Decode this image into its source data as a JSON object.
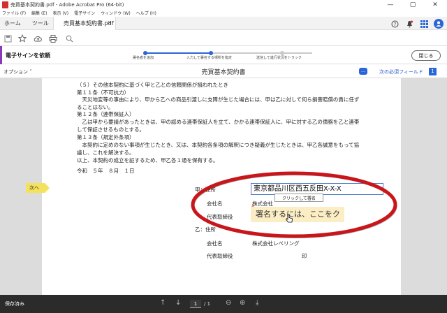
{
  "window": {
    "title": "売買基本契約書.pdf - Adobe Acrobat Pro (64-bit)",
    "minimize": "—",
    "maximize": "▢",
    "close": "✕"
  },
  "menu": [
    "ファイル (F)",
    "編集 (E)",
    "表示 (V)",
    "電子サイン",
    "ウィンドウ (W)",
    "ヘルプ (H)"
  ],
  "tabs": {
    "home": "ホーム",
    "tools": "ツール",
    "document": "売買基本契約書.pdf",
    "close": "✕"
  },
  "sign_bar": {
    "label": "電子サインを依頼",
    "steps": [
      "署名者を追加",
      "入力して署名する場所を指定",
      "送信して進行状況をトラック"
    ],
    "close_button": "閉じる"
  },
  "doc_header": {
    "options": "オプション ˅",
    "title": "売買基本契約書",
    "next_required": "次の必須フィールド",
    "required_count": "1"
  },
  "document": {
    "lines": [
      "（５）その他本契約に基づく甲と乙との信頼関係が損われたとき",
      "第１１条（不可抗力）",
      "　天災地変等の事由により、甲から乙への商品引渡しに支障が生じた場合には、甲は乙に対して何ら損害賠償の責に任ず",
      "ることはない。",
      "第１２条（連帯保証人）",
      "　乙は甲から要請があったときは、甲の認める連帯保証人を立て、かかる連帯保証人に、甲に対する乙の債務を乙と連帯",
      "して保証させるものとする。",
      "第１３条（規定外条項）",
      "　本契約に定めのない事項が生じたとき、又は、本契約各条項の解釈につき疑義が生じたときは、甲乙各誠意をもって協",
      "議し、これを解決する。",
      "",
      "以上、本契約の成立を証するため、甲乙各１通を保有する。",
      "",
      "令和　５年　８月　１日"
    ],
    "party_a_label": "甲：住所",
    "company_label": "会社名",
    "company_a_value": "株式会社",
    "rep_label": "代表取締役",
    "party_b_label": "乙：住所",
    "company_b_value": "株式会社レベリング",
    "seal": "印",
    "address_value": "東京都品川区西五反田X-X-X",
    "tooltip": "クリックして署名",
    "signature_placeholder": "署名するには、ここをク",
    "required_mark": "*"
  },
  "next_tag": "次へ",
  "status": {
    "saved": "保存済み",
    "page_current": "1",
    "page_total": "/ 1"
  },
  "annotation": {
    "ellipse_color": "#c8161b"
  }
}
